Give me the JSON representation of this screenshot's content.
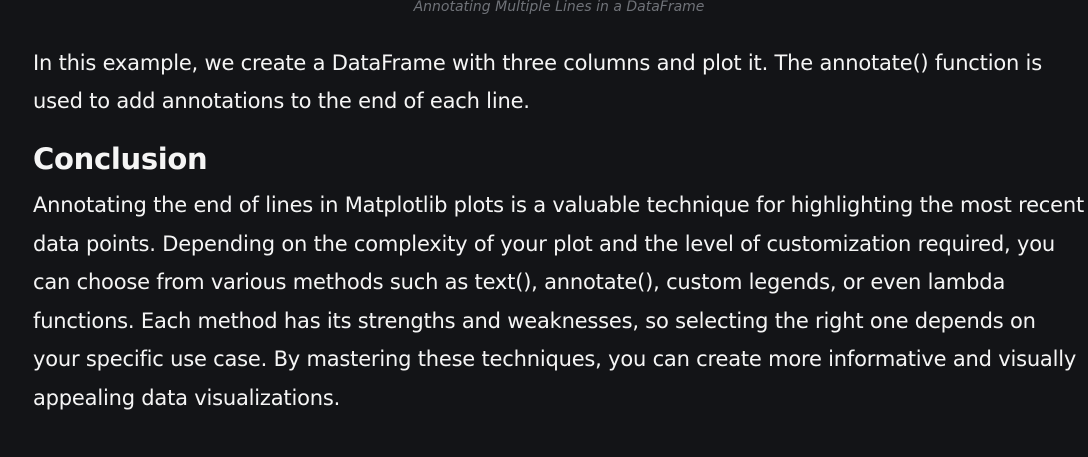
{
  "caption": "Annotating Multiple Lines in a DataFrame",
  "intro": "In this example, we create a DataFrame with three columns and plot it. The annotate() function is used to add annotations to the end of each line.",
  "conclusion": {
    "heading": "Conclusion",
    "body": "Annotating the end of lines in Matplotlib plots is a valuable technique for highlighting the most recent data points. Depending on the complexity of your plot and the level of customization required, you can choose from various methods such as text(), annotate(), custom legends, or even lambda functions. Each method has its strengths and weaknesses, so selecting the right one depends on your specific use case. By mastering these techniques, you can create more informative and visually appealing data visualizations."
  },
  "colors": {
    "background": "#131417",
    "text": "#f5f5f5",
    "caption": "#6f7278"
  }
}
